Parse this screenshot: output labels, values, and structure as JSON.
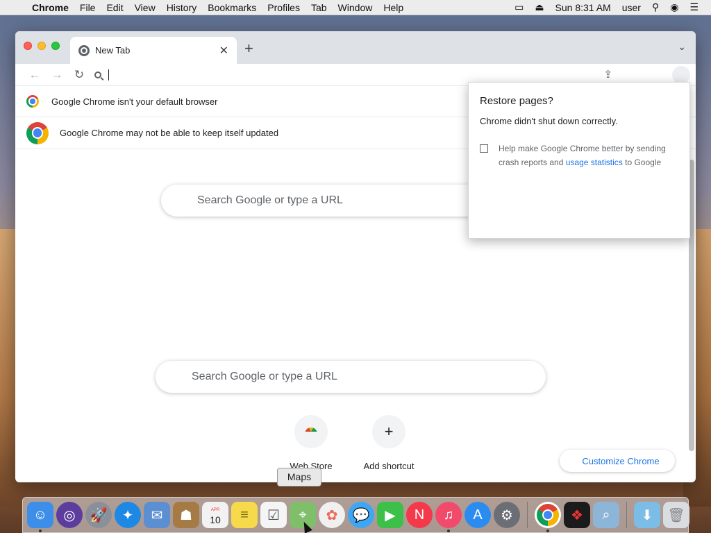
{
  "menubar": {
    "app_name": "Chrome",
    "menus": [
      "File",
      "Edit",
      "View",
      "History",
      "Bookmarks",
      "Profiles",
      "Tab",
      "Window",
      "Help"
    ],
    "clock": "Sun 8:31 AM",
    "user": "user"
  },
  "browser": {
    "tab_title": "New Tab",
    "infobars": [
      "Google Chrome isn't your default browser",
      "Google Chrome may not be able to keep itself updated"
    ],
    "search_placeholder": "Search Google or type a URL",
    "shortcuts": [
      {
        "label": "Web Store",
        "icon": "web-store-icon"
      },
      {
        "label": "Add shortcut",
        "icon": "plus-icon"
      }
    ],
    "customize_label": "Customize Chrome"
  },
  "restore_dialog": {
    "title": "Restore pages?",
    "message": "Chrome didn't shut down correctly.",
    "checkbox_text_1": "Help make Google Chrome better by sending crash reports and",
    "checkbox_link": "usage statistics",
    "checkbox_text_2": "to Google",
    "checked": false
  },
  "tooltip": "Maps",
  "dock": {
    "apps": [
      {
        "name": "finder-icon",
        "color": "#3d8ee8"
      },
      {
        "name": "siri-icon",
        "color": "#5c3d9e"
      },
      {
        "name": "launchpad-icon",
        "color": "#8a9099"
      },
      {
        "name": "safari-icon",
        "color": "#1e88e5"
      },
      {
        "name": "mail-icon",
        "color": "#5b8fd1"
      },
      {
        "name": "contacts-icon",
        "color": "#a57a45"
      },
      {
        "name": "calendar-icon",
        "color": "#f2f2f2"
      },
      {
        "name": "notes-icon",
        "color": "#f7d94c"
      },
      {
        "name": "reminders-icon",
        "color": "#f5f5f5"
      },
      {
        "name": "maps-icon",
        "color": "#7fbf6a"
      },
      {
        "name": "photos-icon",
        "color": "#f0f0f0"
      },
      {
        "name": "messages-icon",
        "color": "#3ea7f5"
      },
      {
        "name": "facetime-icon",
        "color": "#3cc04a"
      },
      {
        "name": "news-icon",
        "color": "#f3394a"
      },
      {
        "name": "music-icon",
        "color": "#f14a6a"
      },
      {
        "name": "app-store-icon",
        "color": "#2a8cf0"
      },
      {
        "name": "system-preferences-icon",
        "color": "#6b6f75"
      },
      {
        "name": "chrome-icon",
        "color": "#ffffff"
      },
      {
        "name": "photo-booth-icon",
        "color": "#1b1b1b"
      },
      {
        "name": "preview-icon",
        "color": "#8cb5d8"
      },
      {
        "name": "downloads-folder-icon",
        "color": "#7cbde8"
      },
      {
        "name": "trash-icon",
        "color": "#d9dde2"
      }
    ],
    "calendar_month": "APR",
    "calendar_day": "10"
  }
}
